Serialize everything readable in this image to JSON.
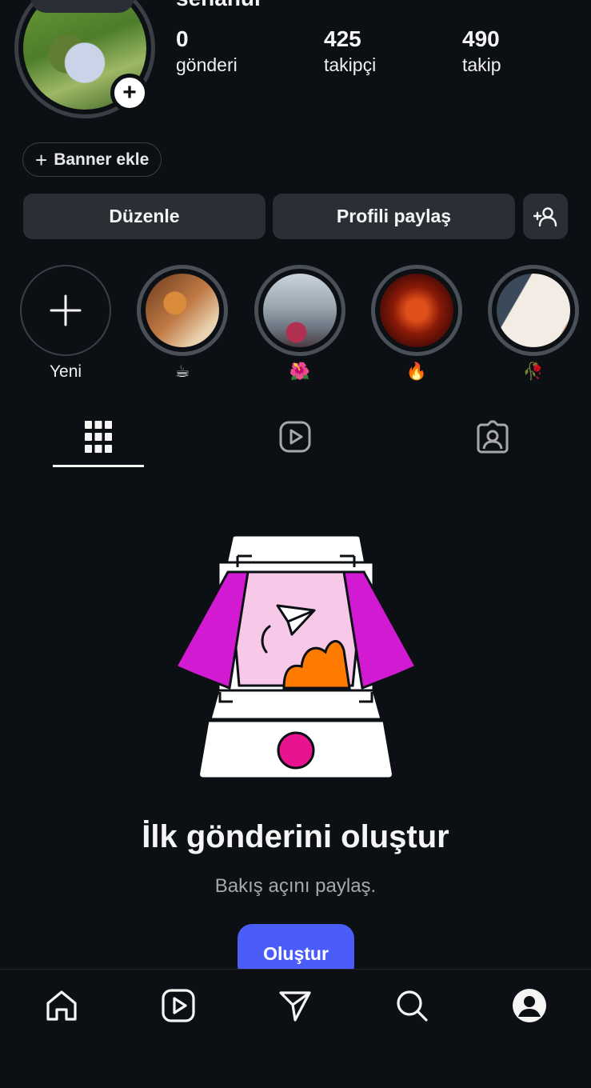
{
  "profile": {
    "username": "sehanur",
    "stats": [
      {
        "value": "0",
        "label": "gönderi"
      },
      {
        "value": "425",
        "label": "takipçi"
      },
      {
        "value": "490",
        "label": "takip"
      }
    ],
    "banner_button": "Banner ekle",
    "edit_button": "Düzenle",
    "share_button": "Profili paylaş"
  },
  "highlights": [
    {
      "label": "Yeni",
      "type": "new"
    },
    {
      "label": "☕",
      "type": "story"
    },
    {
      "label": "🌺",
      "type": "story"
    },
    {
      "label": "🔥",
      "type": "story"
    },
    {
      "label": "🥀",
      "type": "story"
    }
  ],
  "tabs": [
    {
      "icon": "grid-icon",
      "active": true
    },
    {
      "icon": "reels-icon",
      "active": false
    },
    {
      "icon": "tagged-icon",
      "active": false
    }
  ],
  "empty_state": {
    "title": "İlk gönderini oluştur",
    "subtitle": "Bakış açını paylaş.",
    "button": "Oluştur"
  },
  "bottom_nav": [
    {
      "icon": "home-icon"
    },
    {
      "icon": "reels-icon"
    },
    {
      "icon": "send-icon"
    },
    {
      "icon": "search-icon"
    },
    {
      "icon": "profile-icon"
    }
  ],
  "colors": {
    "background": "#0c1014",
    "button": "#2a2f36",
    "accent": "#4a5df9",
    "illustration_magenta": "#d11ad1",
    "illustration_orange": "#ff7a00",
    "illustration_pink": "#e8138f"
  }
}
